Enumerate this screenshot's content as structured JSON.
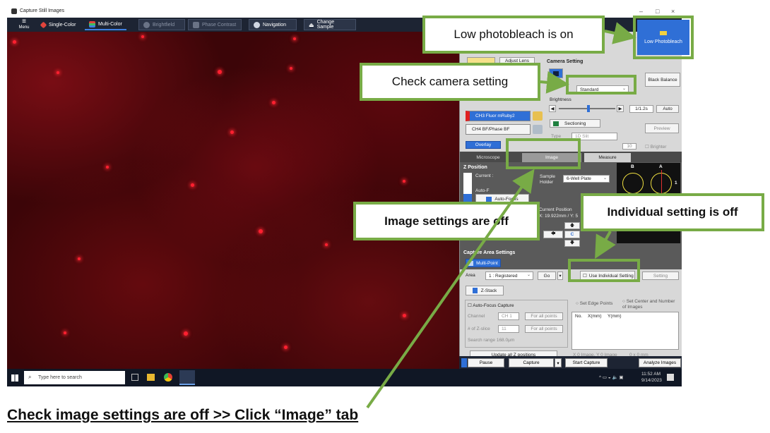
{
  "window": {
    "title": "Capture Still Images",
    "controls": [
      "–",
      "□",
      "×"
    ]
  },
  "toolbar": {
    "menu_label": "Menu",
    "single_color": "Single-Color",
    "multi_color": "Multi-Color",
    "brightfield": "Brightfield",
    "phase_contrast": "Phase Contrast",
    "navigation": "Navigation",
    "change_sample": "Change Sample"
  },
  "panel": {
    "adjust_lens": "Adjust Lens",
    "camera_setting_title": "Camera Setting",
    "camera_mode": "Standard",
    "black_balance": "Black Balance",
    "brightness_label": "Brightness",
    "exposure": "1/1.2s",
    "auto": "Auto",
    "ch3": "CH3 Fluor mRuby2",
    "ch4": "CH4 BF/Phase BF",
    "sectioning": "Sectioning",
    "type_label": "Type",
    "type_value": "1D Slit",
    "preview": "Preview",
    "overlay": "Overlay",
    "brighter": "Brighter",
    "brighter_value": "10",
    "tabs": [
      "Microscope",
      "Image",
      "Measure"
    ],
    "z_position_title": "Z Position",
    "current_label": "Current :",
    "autofocus_label": "Auto-F",
    "autofocus_btn": "Auto-Focus",
    "sample_holder_label": "Sample Holder",
    "sample_holder_value": "6-Well Plate",
    "current_position_label": "Current Position",
    "current_position_value": "X: 19.922mm / Y: 5",
    "well_labels": [
      "B",
      "A"
    ],
    "well_row": "1",
    "capture_area_title": "Capture Area Settings",
    "multi_point": "Multi-Point",
    "area_label": "Area",
    "area_value": "1 : Registered",
    "go": "Go",
    "use_individual": "Use Individual Setting",
    "setting": "Setting",
    "z_stack": "Z-Stack",
    "set_edge_points": "Set Edge Points",
    "set_center": "Set Center and Number of Images",
    "autofocus_capture": "Auto-Focus Capture",
    "channel_label": "Channel",
    "channel_value": "CH 1",
    "for_all_points_1": "For all points",
    "zslice_label": "# of Z-slice",
    "zslice_value": "11",
    "for_all_points_2": "For all points",
    "search_range": "Search range  168.0μm",
    "table_headers": [
      "No.",
      "X(mm)",
      "Y(mm)"
    ],
    "update_all": "Update all Z positions",
    "image_count": "X 0 Image, Y 0 Image",
    "image_size": "0 x 0 mm"
  },
  "bottom": {
    "pause": "Pause",
    "capture": "Capture",
    "start_capture": "Start Capture",
    "analyze_images": "Analyze Images"
  },
  "taskbar": {
    "search_placeholder": "Type here to search",
    "time": "11:52 AM",
    "date": "9/14/2023"
  },
  "low_photobleach": "Low Photobleach",
  "callouts": {
    "low_photobleach": "Low photobleach is on",
    "check_camera": "Check camera setting",
    "image_settings_off": "Image settings are off",
    "individual_off": "Individual setting is off"
  },
  "caption": "Check image settings are off >> Click “Image” tab",
  "colors": {
    "accent_green": "#78ab46",
    "toolbar": "#1d2433",
    "blue": "#2f6fd6"
  }
}
